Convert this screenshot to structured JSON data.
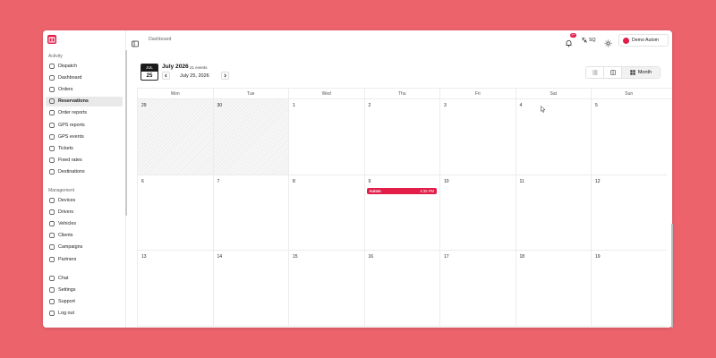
{
  "app": {
    "brand_color": "#e11d48"
  },
  "sidebar": {
    "sections": [
      {
        "label": "Activity",
        "items": [
          {
            "label": "Dispatch",
            "icon": "dispatch-icon"
          },
          {
            "label": "Dashboard",
            "icon": "dashboard-icon"
          },
          {
            "label": "Orders",
            "icon": "orders-icon"
          },
          {
            "label": "Reservations",
            "icon": "reservations-icon",
            "active": true
          },
          {
            "label": "Order reports",
            "icon": "order-reports-icon"
          },
          {
            "label": "GPS reports",
            "icon": "gps-reports-icon"
          },
          {
            "label": "GPS events",
            "icon": "gps-events-icon"
          },
          {
            "label": "Tickets",
            "icon": "tickets-icon"
          },
          {
            "label": "Fixed rates",
            "icon": "fixed-rates-icon"
          },
          {
            "label": "Destinations",
            "icon": "destinations-icon"
          }
        ]
      },
      {
        "label": "Management",
        "items": [
          {
            "label": "Devices",
            "icon": "devices-icon"
          },
          {
            "label": "Drivers",
            "icon": "drivers-icon"
          },
          {
            "label": "Vehicles",
            "icon": "vehicles-icon"
          },
          {
            "label": "Clients",
            "icon": "clients-icon"
          },
          {
            "label": "Campaigns",
            "icon": "campaigns-icon"
          },
          {
            "label": "Partners",
            "icon": "partners-icon"
          }
        ]
      }
    ],
    "footer": [
      {
        "label": "Chat",
        "icon": "chat-icon"
      },
      {
        "label": "Settings",
        "icon": "settings-icon"
      },
      {
        "label": "Support",
        "icon": "support-icon"
      },
      {
        "label": "Log out",
        "icon": "logout-icon"
      }
    ]
  },
  "topbar": {
    "breadcrumb": "Dashboard",
    "notification_badge": "9+",
    "language": "SQ",
    "user_name": "Demo Autom"
  },
  "calendar": {
    "today_month": "JUL",
    "today_day": "25",
    "title": "July 2026",
    "event_count": "21 events",
    "range_label": "July 25, 2026",
    "view_label": "Month",
    "weekdays": [
      "Mon",
      "Tue",
      "Wed",
      "Thu",
      "Fri",
      "Sat",
      "Sun"
    ],
    "weeks": [
      [
        {
          "d": "29",
          "prev": true
        },
        {
          "d": "30",
          "prev": true
        },
        {
          "d": "1"
        },
        {
          "d": "2"
        },
        {
          "d": "3"
        },
        {
          "d": "4"
        },
        {
          "d": "5"
        }
      ],
      [
        {
          "d": "6"
        },
        {
          "d": "7"
        },
        {
          "d": "8"
        },
        {
          "d": "9"
        },
        {
          "d": "10"
        },
        {
          "d": "11"
        },
        {
          "d": "12"
        }
      ],
      [
        {
          "d": "13"
        },
        {
          "d": "14"
        },
        {
          "d": "15"
        },
        {
          "d": "16"
        },
        {
          "d": "17"
        },
        {
          "d": "18"
        },
        {
          "d": "19"
        }
      ]
    ],
    "events": [
      {
        "week": 1,
        "day": 3,
        "title": "Autom",
        "time": "4:35 PM"
      }
    ]
  }
}
